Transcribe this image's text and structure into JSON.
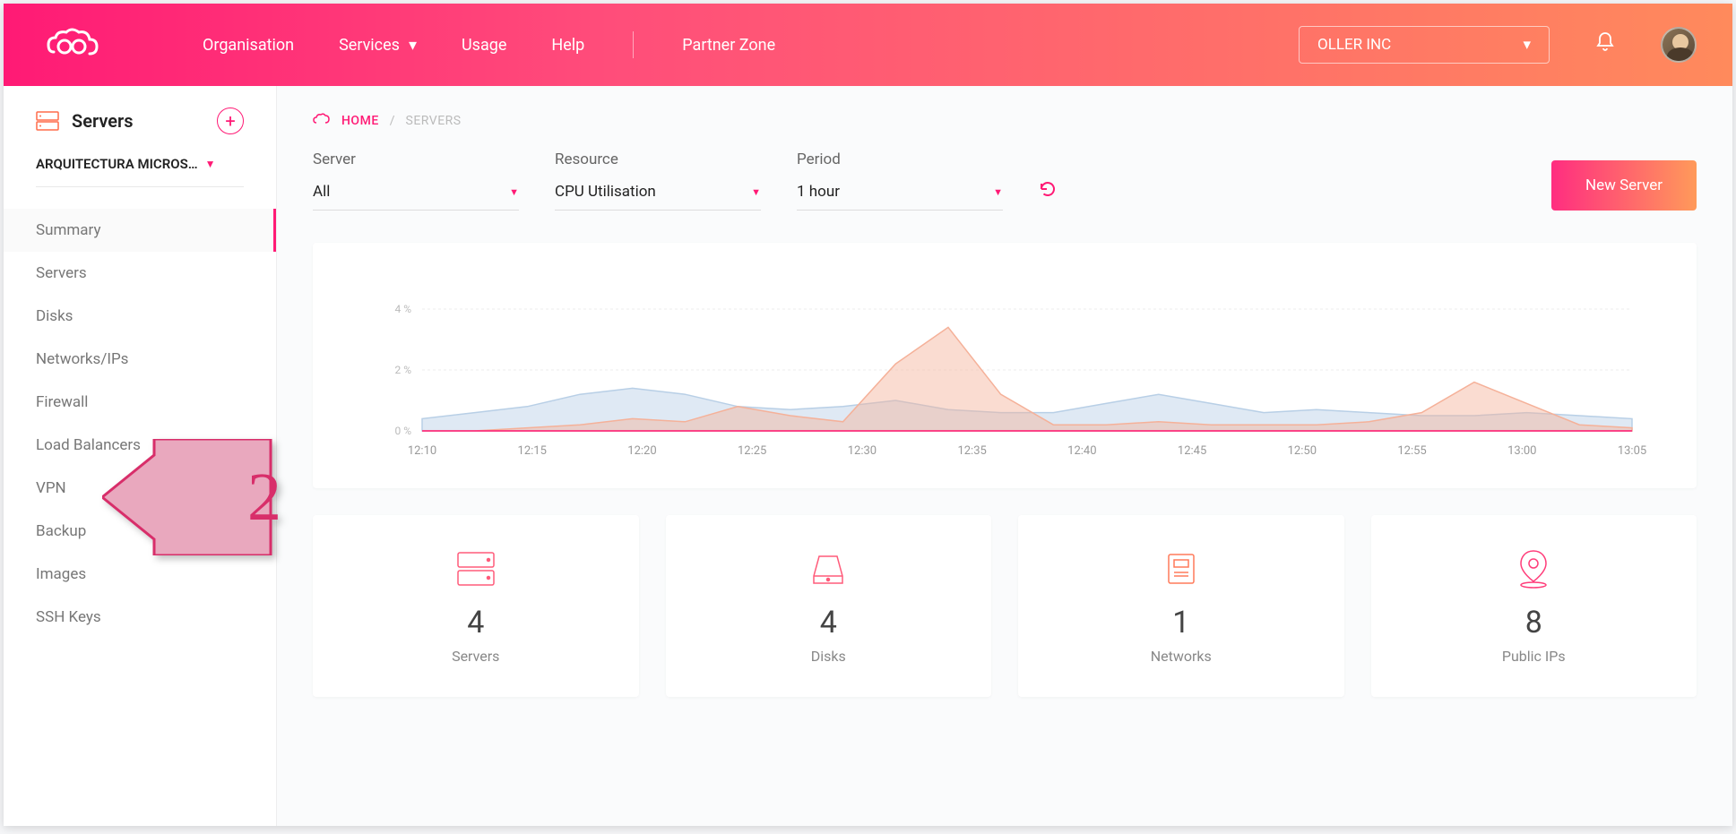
{
  "topbar": {
    "nav": [
      {
        "label": "Organisation",
        "caret": false
      },
      {
        "label": "Services",
        "caret": true
      },
      {
        "label": "Usage",
        "caret": false
      },
      {
        "label": "Help",
        "caret": false
      }
    ],
    "partner_zone": "Partner Zone",
    "org_selected": "OLLER INC"
  },
  "sidebar": {
    "title": "Servers",
    "org": "ARQUITECTURA MICROS…",
    "items": [
      {
        "label": "Summary",
        "active": true
      },
      {
        "label": "Servers"
      },
      {
        "label": "Disks"
      },
      {
        "label": "Networks/IPs"
      },
      {
        "label": "Firewall"
      },
      {
        "label": "Load Balancers"
      },
      {
        "label": "VPN"
      },
      {
        "label": "Backup"
      },
      {
        "label": "Images"
      },
      {
        "label": "SSH Keys"
      }
    ]
  },
  "breadcrumb": {
    "home": "HOME",
    "current": "SERVERS"
  },
  "filters": {
    "server": {
      "label": "Server",
      "value": "All"
    },
    "resource": {
      "label": "Resource",
      "value": "CPU Utilisation"
    },
    "period": {
      "label": "Period",
      "value": "1 hour"
    }
  },
  "new_server_btn": "New Server",
  "chart_data": {
    "type": "area",
    "title": "",
    "xlabel": "",
    "ylabel": "",
    "ylim": [
      0,
      5
    ],
    "y_ticks": [
      "0 %",
      "2 %",
      "4 %"
    ],
    "x_ticks": [
      "12:10",
      "12:15",
      "12:20",
      "12:25",
      "12:30",
      "12:35",
      "12:40",
      "12:45",
      "12:50",
      "12:55",
      "13:00",
      "13:05"
    ],
    "series": [
      {
        "name": "blue",
        "color": "#b8cfe6",
        "values": [
          0.4,
          0.6,
          0.8,
          1.2,
          1.4,
          1.2,
          0.8,
          0.7,
          0.8,
          1.0,
          0.7,
          0.6,
          0.6,
          0.9,
          1.2,
          0.9,
          0.6,
          0.7,
          0.6,
          0.5,
          0.5,
          0.6,
          0.5,
          0.4
        ]
      },
      {
        "name": "orange",
        "color": "#f5b199",
        "values": [
          0.0,
          0.0,
          0.1,
          0.2,
          0.4,
          0.3,
          0.8,
          0.5,
          0.3,
          2.2,
          3.4,
          1.2,
          0.2,
          0.2,
          0.3,
          0.2,
          0.2,
          0.2,
          0.3,
          0.6,
          1.6,
          0.9,
          0.2,
          0.1
        ]
      }
    ]
  },
  "stats": [
    {
      "icon": "servers",
      "value": "4",
      "label": "Servers"
    },
    {
      "icon": "disks",
      "value": "4",
      "label": "Disks"
    },
    {
      "icon": "networks",
      "value": "1",
      "label": "Networks"
    },
    {
      "icon": "publicips",
      "value": "8",
      "label": "Public IPs"
    }
  ],
  "annotation": {
    "number": "2"
  }
}
